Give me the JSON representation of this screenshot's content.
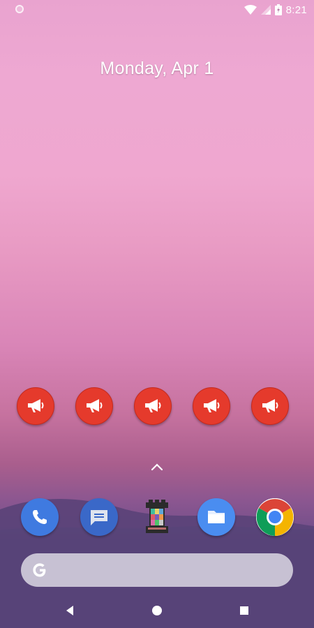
{
  "status_bar": {
    "time": "8:21",
    "icons": [
      "notification-dot-icon",
      "wifi-icon",
      "cell-signal-icon",
      "battery-charging-icon"
    ]
  },
  "home": {
    "date": "Monday, Apr 1",
    "shortcuts": [
      {
        "icon": "megaphone-icon"
      },
      {
        "icon": "megaphone-icon"
      },
      {
        "icon": "megaphone-icon"
      },
      {
        "icon": "megaphone-icon"
      },
      {
        "icon": "megaphone-icon"
      }
    ]
  },
  "dock": [
    {
      "name": "phone",
      "icon": "phone-icon",
      "color": "#3f7ae0"
    },
    {
      "name": "messages",
      "icon": "message-icon",
      "color": "#3a68c8"
    },
    {
      "name": "game",
      "icon": "chess-rook-icon",
      "color": "transparent"
    },
    {
      "name": "files",
      "icon": "folder-icon",
      "color": "#4a8df0"
    },
    {
      "name": "chrome",
      "icon": "chrome-icon",
      "color": "#ffffff"
    }
  ],
  "search": {
    "icon": "google-g-icon"
  },
  "navigation": {
    "icons": [
      "back-icon",
      "home-icon",
      "recents-icon"
    ]
  },
  "colors": {
    "shortcut_red": "#e53a2c",
    "accent": "#4285f4"
  }
}
